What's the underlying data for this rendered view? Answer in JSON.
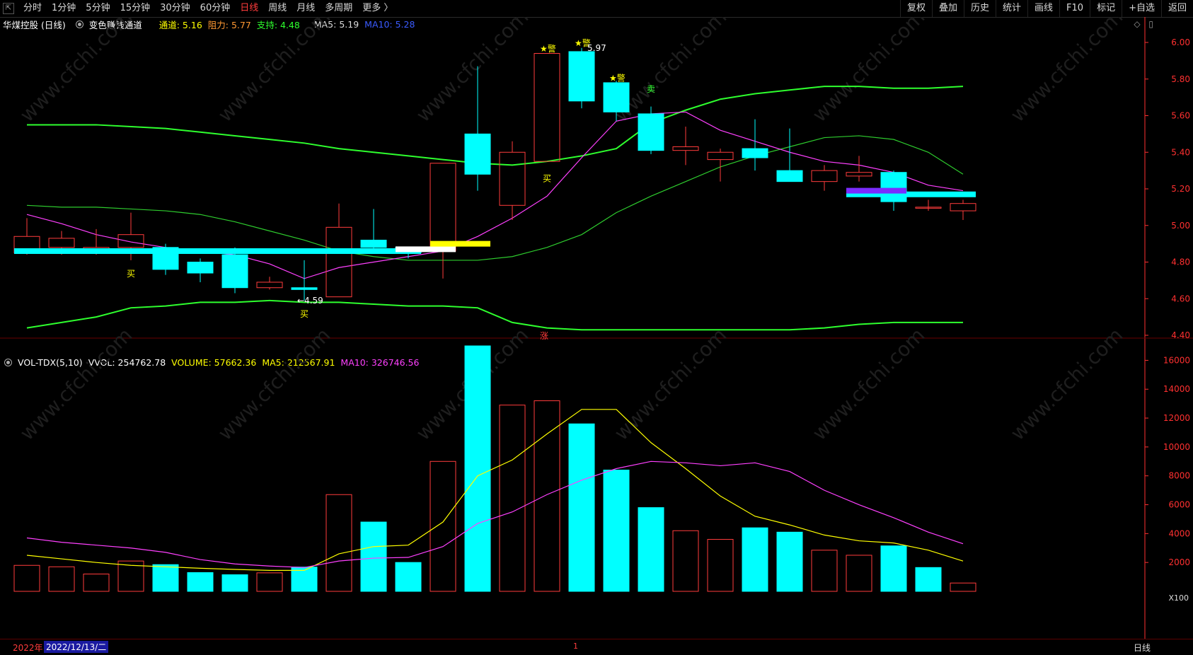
{
  "toolbar": {
    "periods": [
      {
        "label": "分时",
        "active": false
      },
      {
        "label": "1分钟",
        "active": false
      },
      {
        "label": "5分钟",
        "active": false
      },
      {
        "label": "15分钟",
        "active": false
      },
      {
        "label": "30分钟",
        "active": false
      },
      {
        "label": "60分钟",
        "active": false
      },
      {
        "label": "日线",
        "active": true
      },
      {
        "label": "周线",
        "active": false
      },
      {
        "label": "月线",
        "active": false
      },
      {
        "label": "多周期",
        "active": false
      },
      {
        "label": "更多 〉",
        "active": false
      }
    ],
    "right_buttons": [
      "复权",
      "叠加",
      "历史",
      "统计",
      "画线",
      "F10",
      "标记",
      "+自选",
      "返回"
    ]
  },
  "main_info": {
    "stock": "华煤控股 (日线)",
    "indicator": "变色赚钱通道",
    "channel": "通道: 5.16",
    "resistance": "阻力: 5.77",
    "support": "支持: 4.48",
    "ma5": "MA5: 5.19",
    "ma10": "MA10: 5.28"
  },
  "vol_info": {
    "name": "VOL-TDX(5,10)",
    "vvol": "VVOL: 254762.78",
    "volume": "VOLUME: 57662.36",
    "ma5": "MA5: 212567.91",
    "ma10": "MA10: 326746.56"
  },
  "bottom": {
    "year": "2022年",
    "date": "2022/12/13/二",
    "marker": "1",
    "period": "日线",
    "scale": "X100"
  },
  "colors": {
    "up": "#ff3c3c",
    "down": "#00ffff",
    "channel_upper": "#2eff2e",
    "channel_mid": "#2ecc2e",
    "ma5": "#ff40ff",
    "ma10": "#ff40ff",
    "vol_ma5": "#ffff00",
    "vol_ma10": "#ff40ff",
    "axis": "#ff3030"
  },
  "chart_data": {
    "type": "candlestick",
    "price_axis": {
      "ticks": [
        "6.00",
        "5.80",
        "5.60",
        "5.40",
        "5.20",
        "5.00",
        "4.80",
        "4.60",
        "4.40"
      ],
      "range": [
        4.4,
        6.0
      ]
    },
    "volume_axis": {
      "ticks": [
        "16000",
        "14000",
        "12000",
        "10000",
        "8000",
        "6000",
        "4000",
        "2000"
      ],
      "range": [
        0,
        17000
      ],
      "unit": "X100"
    },
    "candles": [
      {
        "o": 4.85,
        "c": 4.94,
        "h": 5.04,
        "l": 4.84
      },
      {
        "o": 4.88,
        "c": 4.93,
        "h": 4.97,
        "l": 4.84
      },
      {
        "o": 4.87,
        "c": 4.88,
        "h": 4.98,
        "l": 4.84
      },
      {
        "o": 4.88,
        "c": 4.95,
        "h": 5.07,
        "l": 4.81
      },
      {
        "o": 4.88,
        "c": 4.76,
        "h": 4.9,
        "l": 4.73
      },
      {
        "o": 4.8,
        "c": 4.74,
        "h": 4.82,
        "l": 4.69
      },
      {
        "o": 4.84,
        "c": 4.66,
        "h": 4.88,
        "l": 4.63
      },
      {
        "o": 4.66,
        "c": 4.69,
        "h": 4.72,
        "l": 4.65
      },
      {
        "o": 4.66,
        "c": 4.65,
        "h": 4.81,
        "l": 4.59
      },
      {
        "o": 4.61,
        "c": 4.99,
        "h": 5.12,
        "l": 4.61
      },
      {
        "o": 4.92,
        "c": 4.88,
        "h": 5.09,
        "l": 4.86
      },
      {
        "o": 4.88,
        "c": 4.85,
        "h": 4.88,
        "l": 4.82
      },
      {
        "o": 4.86,
        "c": 5.34,
        "h": 5.34,
        "l": 4.71
      },
      {
        "o": 5.5,
        "c": 5.28,
        "h": 5.87,
        "l": 5.19
      },
      {
        "o": 5.11,
        "c": 5.4,
        "h": 5.46,
        "l": 5.03
      },
      {
        "o": 5.35,
        "c": 5.94,
        "h": 5.94,
        "l": 5.35
      },
      {
        "o": 5.95,
        "c": 5.68,
        "h": 5.97,
        "l": 5.64
      },
      {
        "o": 5.78,
        "c": 5.62,
        "h": 5.79,
        "l": 5.57
      },
      {
        "o": 5.61,
        "c": 5.41,
        "h": 5.65,
        "l": 5.39
      },
      {
        "o": 5.41,
        "c": 5.43,
        "h": 5.54,
        "l": 5.33
      },
      {
        "o": 5.36,
        "c": 5.4,
        "h": 5.42,
        "l": 5.24
      },
      {
        "o": 5.42,
        "c": 5.37,
        "h": 5.58,
        "l": 5.3
      },
      {
        "o": 5.3,
        "c": 5.24,
        "h": 5.53,
        "l": 5.24
      },
      {
        "o": 5.24,
        "c": 5.3,
        "h": 5.33,
        "l": 5.19
      },
      {
        "o": 5.27,
        "c": 5.29,
        "h": 5.38,
        "l": 5.24
      },
      {
        "o": 5.29,
        "c": 5.13,
        "h": 5.3,
        "l": 5.08
      },
      {
        "o": 5.1,
        "c": 5.1,
        "h": 5.14,
        "l": 5.08
      },
      {
        "o": 5.08,
        "c": 5.12,
        "h": 5.14,
        "l": 5.03
      }
    ],
    "channel_upper": [
      5.55,
      5.55,
      5.55,
      5.54,
      5.53,
      5.51,
      5.49,
      5.47,
      5.45,
      5.42,
      5.4,
      5.38,
      5.36,
      5.34,
      5.33,
      5.35,
      5.38,
      5.42,
      5.56,
      5.63,
      5.69,
      5.72,
      5.74,
      5.76,
      5.76,
      5.75,
      5.75,
      5.76
    ],
    "channel_mid": [
      5.11,
      5.1,
      5.1,
      5.09,
      5.08,
      5.06,
      5.02,
      4.97,
      4.92,
      4.86,
      4.83,
      4.81,
      4.81,
      4.81,
      4.83,
      4.88,
      4.95,
      5.07,
      5.16,
      5.24,
      5.32,
      5.38,
      5.43,
      5.48,
      5.49,
      5.47,
      5.4,
      5.28
    ],
    "channel_lower": [
      4.44,
      4.47,
      4.5,
      4.55,
      4.56,
      4.58,
      4.58,
      4.59,
      4.58,
      4.58,
      4.57,
      4.56,
      4.56,
      4.55,
      4.47,
      4.44,
      4.43,
      4.43,
      4.43,
      4.43,
      4.43,
      4.43,
      4.43,
      4.44,
      4.46,
      4.47,
      4.47,
      4.47
    ],
    "ma5": [
      5.06,
      5.01,
      4.95,
      4.91,
      4.88,
      4.86,
      4.84,
      4.79,
      4.71,
      4.77,
      4.8,
      4.83,
      4.86,
      4.94,
      5.04,
      5.16,
      5.37,
      5.57,
      5.61,
      5.62,
      5.52,
      5.46,
      5.4,
      5.35,
      5.33,
      5.29,
      5.22,
      5.19
    ],
    "volume": [
      1800,
      1700,
      1200,
      2100,
      1850,
      1300,
      1150,
      1280,
      1680,
      6700,
      4800,
      2000,
      9000,
      17000,
      12900,
      13200,
      11600,
      8400,
      5800,
      4200,
      3600,
      4400,
      4100,
      2850,
      2500,
      3150,
      1650,
      577
    ],
    "volume_up": [
      true,
      true,
      true,
      true,
      false,
      false,
      false,
      true,
      false,
      true,
      false,
      false,
      true,
      false,
      true,
      true,
      false,
      false,
      false,
      true,
      true,
      false,
      false,
      true,
      true,
      false,
      false,
      true
    ],
    "vol_ma5": [
      2500,
      2250,
      2000,
      1800,
      1700,
      1600,
      1520,
      1450,
      1450,
      2600,
      3100,
      3200,
      4800,
      8000,
      9100,
      10900,
      12600,
      12600,
      10300,
      8500,
      6600,
      5200,
      4600,
      3900,
      3500,
      3350,
      2850,
      2100
    ],
    "vol_ma10": [
      3700,
      3400,
      3200,
      3000,
      2700,
      2200,
      1900,
      1750,
      1650,
      2100,
      2300,
      2350,
      3100,
      4700,
      5500,
      6700,
      7700,
      8500,
      9000,
      8900,
      8700,
      8900,
      8300,
      7000,
      6000,
      5100,
      4100,
      3300
    ],
    "labels": [
      {
        "text": "买",
        "candle": 3
      },
      {
        "text": "买",
        "candle": 8
      },
      {
        "text": "←4.59",
        "candle": 8
      },
      {
        "text": "买",
        "candle": 15
      },
      {
        "text": "★警",
        "candle": 15
      },
      {
        "text": "★警",
        "candle": 16
      },
      {
        "text": "5.97",
        "candle": 16
      },
      {
        "text": "★警",
        "candle": 17
      },
      {
        "text": "卖",
        "candle": 18
      },
      {
        "text": "涨",
        "candle": 15
      }
    ]
  }
}
